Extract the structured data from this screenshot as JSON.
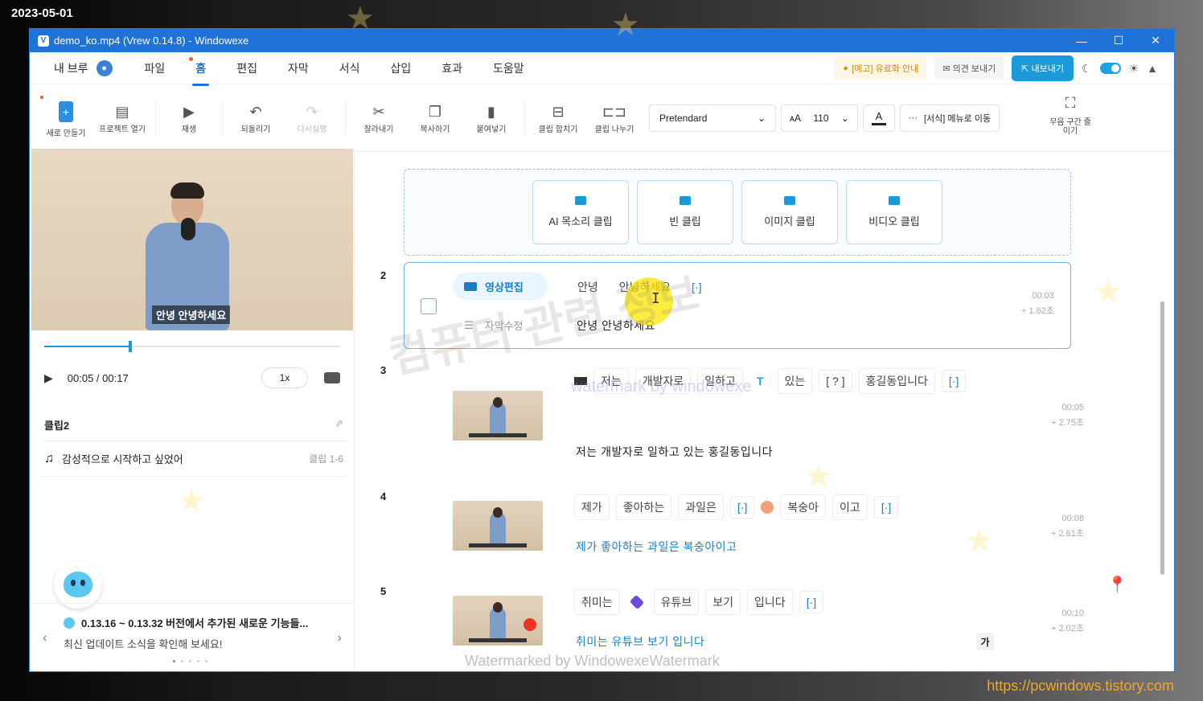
{
  "stamp": {
    "date": "2023-05-01",
    "url": "https://pcwindows.tistory.com"
  },
  "window": {
    "title": "demo_ko.mp4  (Vrew 0.14.8)   - Windowexe",
    "logo": "V"
  },
  "menu": {
    "user": "내 브루",
    "items": [
      "파일",
      "홈",
      "편집",
      "자막",
      "서식",
      "삽입",
      "효과",
      "도움말"
    ],
    "notice": "[예고] 유료화 안내",
    "feedback": "의견 보내기",
    "export": "내보내기"
  },
  "toolbar": {
    "new": "새로 만들기",
    "open": "프로젝트 열기",
    "play": "재생",
    "undo": "되돌리기",
    "redo": "다시실행",
    "cut": "잘라내기",
    "copy": "복사하기",
    "paste": "붙여넣기",
    "merge": "클립 합치기",
    "split": "클립 나누기",
    "font": "Pretendard",
    "font_size": "110",
    "color_glyph": "A",
    "format_move": "[서식] 메뉴로 이동",
    "silence": "무음 구간 줄이기"
  },
  "player": {
    "caption": "안녕 안녕하세요",
    "time": "00:05 / 00:17",
    "speed": "1x",
    "progress": 0.29
  },
  "clip_panel": {
    "title": "클립2",
    "item": "감성적으로 시작하고 싶었어",
    "range": "클립 1-6"
  },
  "update": {
    "title": "0.13.16 ~ 0.13.32 버전에서 추가된 새로운 기능들...",
    "subtitle": "최신 업데이트 소식을 확인해 보세요!"
  },
  "add_clips": [
    "AI 목소리 클립",
    "빈 클립",
    "이미지 클립",
    "비디오 클립"
  ],
  "clips": [
    {
      "num": "2",
      "video_label": "영상편집",
      "sub_label": "자막수정",
      "words": [
        "안녕",
        "안녕하세요",
        "[·]"
      ],
      "subtitle": "안녕  안녕하세요",
      "time": "00:03",
      "duration": "+ 1.62초"
    },
    {
      "num": "3",
      "words": [
        "저는",
        "개발자로",
        "일하고",
        "T",
        "있는",
        "[ ? ]",
        "홍길동입니다",
        "[·]"
      ],
      "subtitle": "저는  개발자로  일하고  있는  홍길동입니다",
      "time": "00:05",
      "duration": "+ 2.75초"
    },
    {
      "num": "4",
      "words": [
        "제가",
        "좋아하는",
        "과일은",
        "[·]",
        "복숭아",
        "이고",
        "[·]"
      ],
      "subtitle": "제가  좋아하는  과일은  복숭아이고",
      "time": "00:08",
      "duration": "+ 2.61초"
    },
    {
      "num": "5",
      "words": [
        "취미는",
        "유튜브",
        "보기",
        "입니다",
        "[·]"
      ],
      "subtitle": "취미는  유튜브  보기  입니다",
      "time": "00:10",
      "duration": "+ 2.02초",
      "ga": "가"
    }
  ],
  "watermarks": {
    "korean": "컴퓨터 관련 정보",
    "english": "watermark by windowexe",
    "bottom": "Watermarked by WindowexeWatermark"
  },
  "icons": {
    "minimize": "minimize-icon",
    "maximize": "maximize-icon",
    "close": "close-icon",
    "music": "music-note-icon",
    "pin": "pin-icon"
  }
}
